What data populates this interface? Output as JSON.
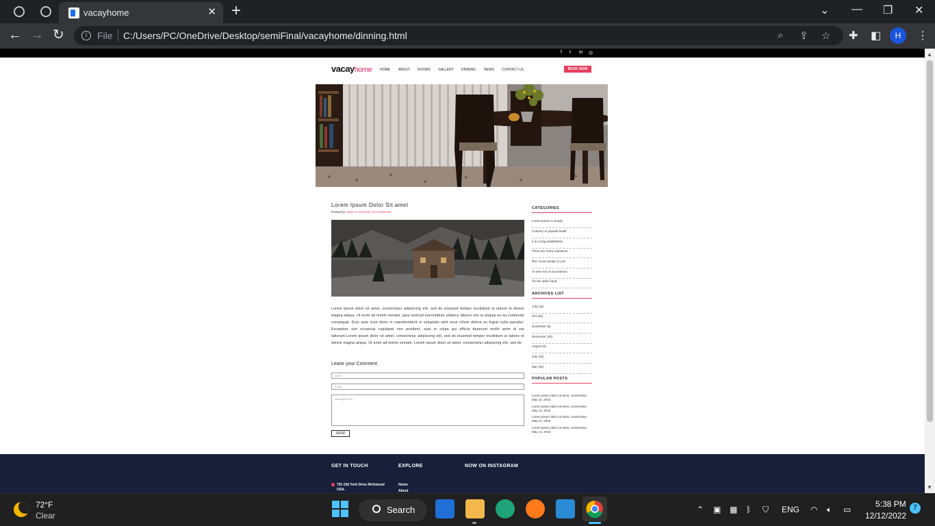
{
  "browser": {
    "tab_title": "vacayhome",
    "address_scheme": "File",
    "url": "C:/Users/PC/OneDrive/Desktop/semiFinal/vacayhome/dinning.html",
    "profile_initial": "H"
  },
  "site": {
    "logo_main": "vacay",
    "logo_accent": "home",
    "nav": [
      "HOME",
      "ABOUT",
      "ROOMS",
      "GALLERY",
      "DINNING",
      "NEWS",
      "CONTACT US"
    ],
    "book_now": "BOOK NOW",
    "social_icons": [
      "facebook-icon",
      "twitter-icon",
      "linkedin-icon",
      "instagram-icon"
    ],
    "post": {
      "title": "Lorem Ipsum Dolor Sit amet",
      "meta_prefix": "Posted by ",
      "meta_author": "Admin",
      "meta_category": "In General",
      "meta_comments": "| 10 Comments",
      "body": "Lorem ipsum dolor sit amet, consectetur adipiscing elit, sed do eiusmod tempor incididunt ut labore et dolore magna aliqua. Ut enim ad minim veniam, quis nostrud exercitation ullamco laboris nisi ut aliquip ex ea commodo consequat. Duis aute irure dolor in reprehenderit in voluptate velit esse cillum dolore eu fugiat nulla pariatur. Excepteur sint occaecat cupidatat non proident, sunt in culpa qui officia deserunt mollit anim id est laborum.Lorem ipsum dolor sit amet, consectetur adipiscing elit, sed do eiusmod tempor incididunt ut labore et dolore magna aliqua. Ut enim ad minim veniam, Lorem ipsum dolor sit amet, consectetur adipiscing elit, sed do"
    },
    "comment_form": {
      "heading": "Leave your Comment",
      "name_placeholder": "Name",
      "email_placeholder": "Email",
      "message_placeholder": "Message Here...",
      "send": "SEND"
    },
    "sidebar": {
      "categories_title": "CATEGORIES",
      "categories": [
        "Lorem Ipsum is simply",
        "Contrary to popular belief",
        "It is a long established",
        "There are many variations",
        "But I must explain to you",
        "At vero eos et accusamus",
        "On the other hand"
      ],
      "archives_title": "ARCHIVES LIST",
      "archives": [
        "July (15)",
        "Oct (20)",
        "November (9)",
        "December (25)",
        "August (9)",
        "July (15)",
        "Mar (25)"
      ],
      "popular_title": "POPULAR POSTS",
      "popular": [
        {
          "title": "Lorem ipsum dolor sit amet, consectetur",
          "date": "May 14, 2016"
        },
        {
          "title": "Lorem ipsum dolor sit amet, consectetur",
          "date": "May 14, 2016"
        },
        {
          "title": "Lorem ipsum dolor sit amet, consectetur",
          "date": "May 14, 2016"
        },
        {
          "title": "Lorem ipsum dolor sit amet, consectetur",
          "date": "May 14, 2016"
        }
      ]
    },
    "footer": {
      "col1": "GET IN TOUCH",
      "col2": "EXPLORE",
      "col3": "NOW ON INSTAGRAM",
      "address_line1": "701 Old York Drive Richmond",
      "address_line2": "USA.",
      "explore_links": [
        "Home",
        "About"
      ]
    }
  },
  "taskbar": {
    "temperature": "72°F",
    "condition": "Clear",
    "search_label": "Search",
    "language": "ENG",
    "time": "5:38 PM",
    "date": "12/12/2022",
    "notifications": "7"
  },
  "colors": {
    "accent_pink": "#e63e5c",
    "footer_navy": "#172038",
    "chrome_dark": "#202124"
  }
}
